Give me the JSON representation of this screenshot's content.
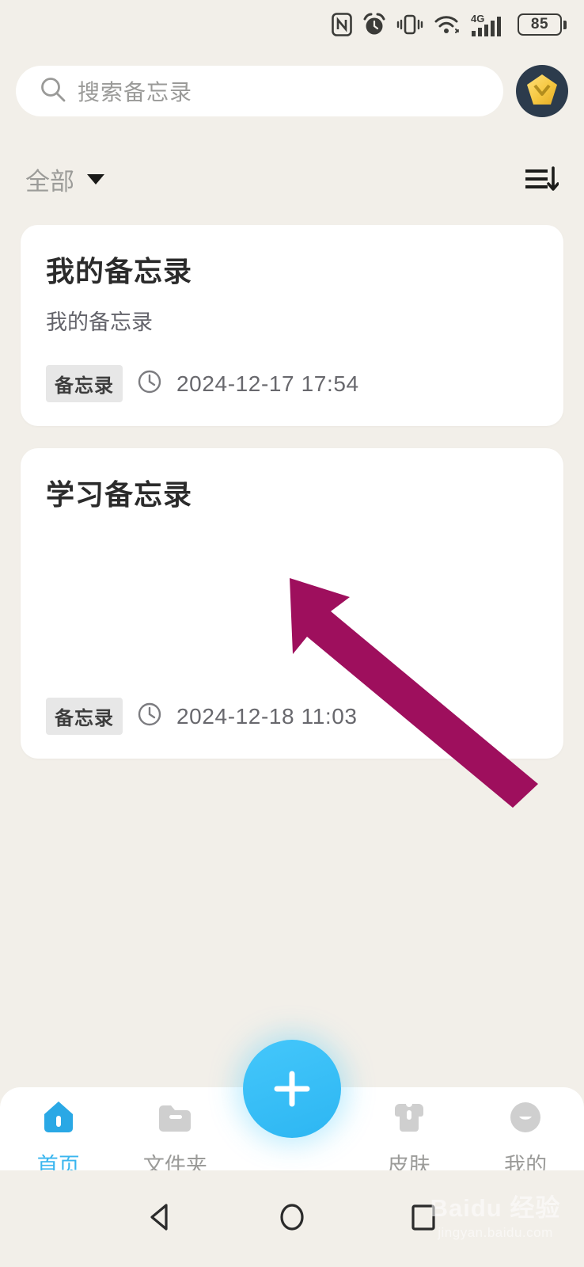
{
  "status_bar": {
    "icons": [
      "nfc-icon",
      "alarm-icon",
      "vibrate-icon",
      "wifi-icon",
      "signal-4g-icon"
    ],
    "network_label": "4G",
    "battery_level": "85"
  },
  "search": {
    "placeholder": "搜索备忘录",
    "icon": "search-icon",
    "avatar_icon": "user-avatar-diamond"
  },
  "filter": {
    "label": "全部",
    "caret_icon": "chevron-down-icon",
    "sort_icon": "sort-descending-icon"
  },
  "notes": [
    {
      "title": "我的备忘录",
      "body": "我的备忘录",
      "tag": "备忘录",
      "clock_icon": "clock-icon",
      "time": "2024-12-17 17:54"
    },
    {
      "title": "学习备忘录",
      "body": "",
      "tag": "备忘录",
      "clock_icon": "clock-icon",
      "time": "2024-12-18 11:03"
    }
  ],
  "annotation": {
    "arrow_color": "#9e0f5d",
    "name": "pointer-arrow"
  },
  "bottom_nav": {
    "items": [
      {
        "label": "首页",
        "icon": "home-icon",
        "active": true
      },
      {
        "label": "文件夹",
        "icon": "folder-icon",
        "active": false
      },
      {
        "label": "皮肤",
        "icon": "shirt-skin-icon",
        "active": false
      },
      {
        "label": "我的",
        "icon": "profile-icon",
        "active": false
      }
    ],
    "fab": {
      "icon": "plus-icon",
      "color": "#33bdf5"
    }
  },
  "android_nav": {
    "back": "back-triangle-icon",
    "home": "home-circle-icon",
    "recents": "recents-square-icon"
  },
  "watermark": {
    "main": "Baidu 经验",
    "sub": "jingyan.baidu.com"
  },
  "colors": {
    "background": "#f2efe9",
    "card": "#ffffff",
    "accent_blue": "#33bdf5",
    "arrow": "#9e0f5d"
  }
}
